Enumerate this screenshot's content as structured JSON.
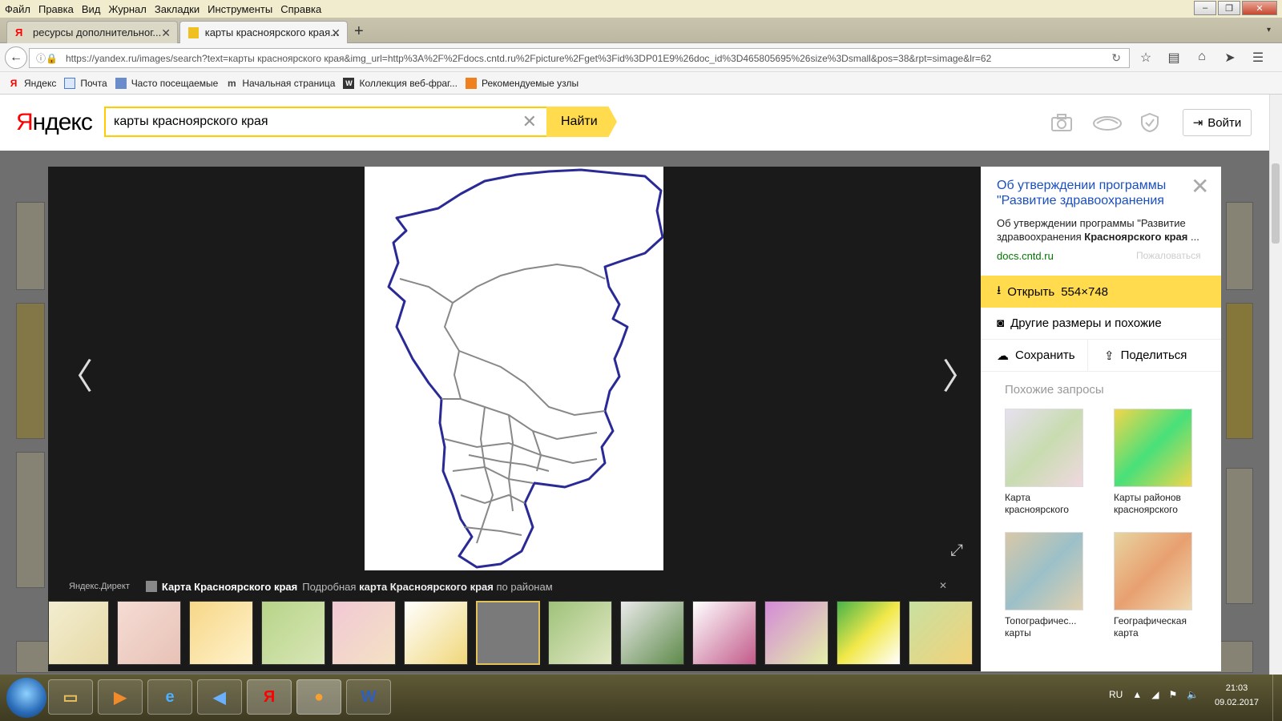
{
  "browser": {
    "menu": [
      "Файл",
      "Правка",
      "Вид",
      "Журнал",
      "Закладки",
      "Инструменты",
      "Справка"
    ],
    "tabs": [
      {
        "label": "ресурсы дополнительног...",
        "active": false
      },
      {
        "label": "карты красноярского края...",
        "active": true
      }
    ],
    "url": "https://yandex.ru/images/search?text=карты красноярского края&img_url=http%3A%2F%2Fdocs.cntd.ru%2Fpicture%2Fget%3Fid%3DP01E9%26doc_id%3D465805695%26size%3Dsmall&pos=38&rpt=simage&lr=62",
    "bookmarks": [
      "Яндекс",
      "Почта",
      "Часто посещаемые",
      "Начальная страница",
      "Коллекция веб-фраг...",
      "Рекомендуемые узлы"
    ]
  },
  "yandex": {
    "logo_first": "Я",
    "logo_rest": "ндекс",
    "search_value": "карты красноярского края",
    "find_label": "Найти",
    "login_label": "Войти"
  },
  "viewer": {
    "direct_label": "Яндекс.Директ",
    "direct_title": "Карта Красноярского края",
    "direct_text_1": "Подробная",
    "direct_text_bold": "карта Красноярского края",
    "direct_text_2": "по районам"
  },
  "panel": {
    "title": "Об утверждении программы \"Развитие здравоохранения",
    "desc_plain": "Об утверждении программы \"Развитие здравоохранения",
    "desc_bold": "Красноярского края",
    "desc_ellipsis": "...",
    "domain": "docs.cntd.ru",
    "complain": "Пожаловаться",
    "open_label": "Открыть",
    "open_size": "554×748",
    "other_sizes": "Другие размеры и похожие",
    "save": "Сохранить",
    "share": "Поделиться",
    "similar_heading": "Похожие запросы",
    "similar": [
      {
        "line1": "Карта",
        "line2": "красноярского"
      },
      {
        "line1": "Карты районов",
        "line2": "красноярского"
      },
      {
        "line1": "Топографичес...",
        "line2": "карты"
      },
      {
        "line1": "Географическая",
        "line2": "карта"
      }
    ]
  },
  "taskbar": {
    "lang": "RU",
    "time": "21:03",
    "date": "09.02.2017"
  },
  "colors": {
    "yandex_yellow": "#ffdb4d",
    "link_blue": "#1a4fbf",
    "domain_green": "#007700"
  }
}
